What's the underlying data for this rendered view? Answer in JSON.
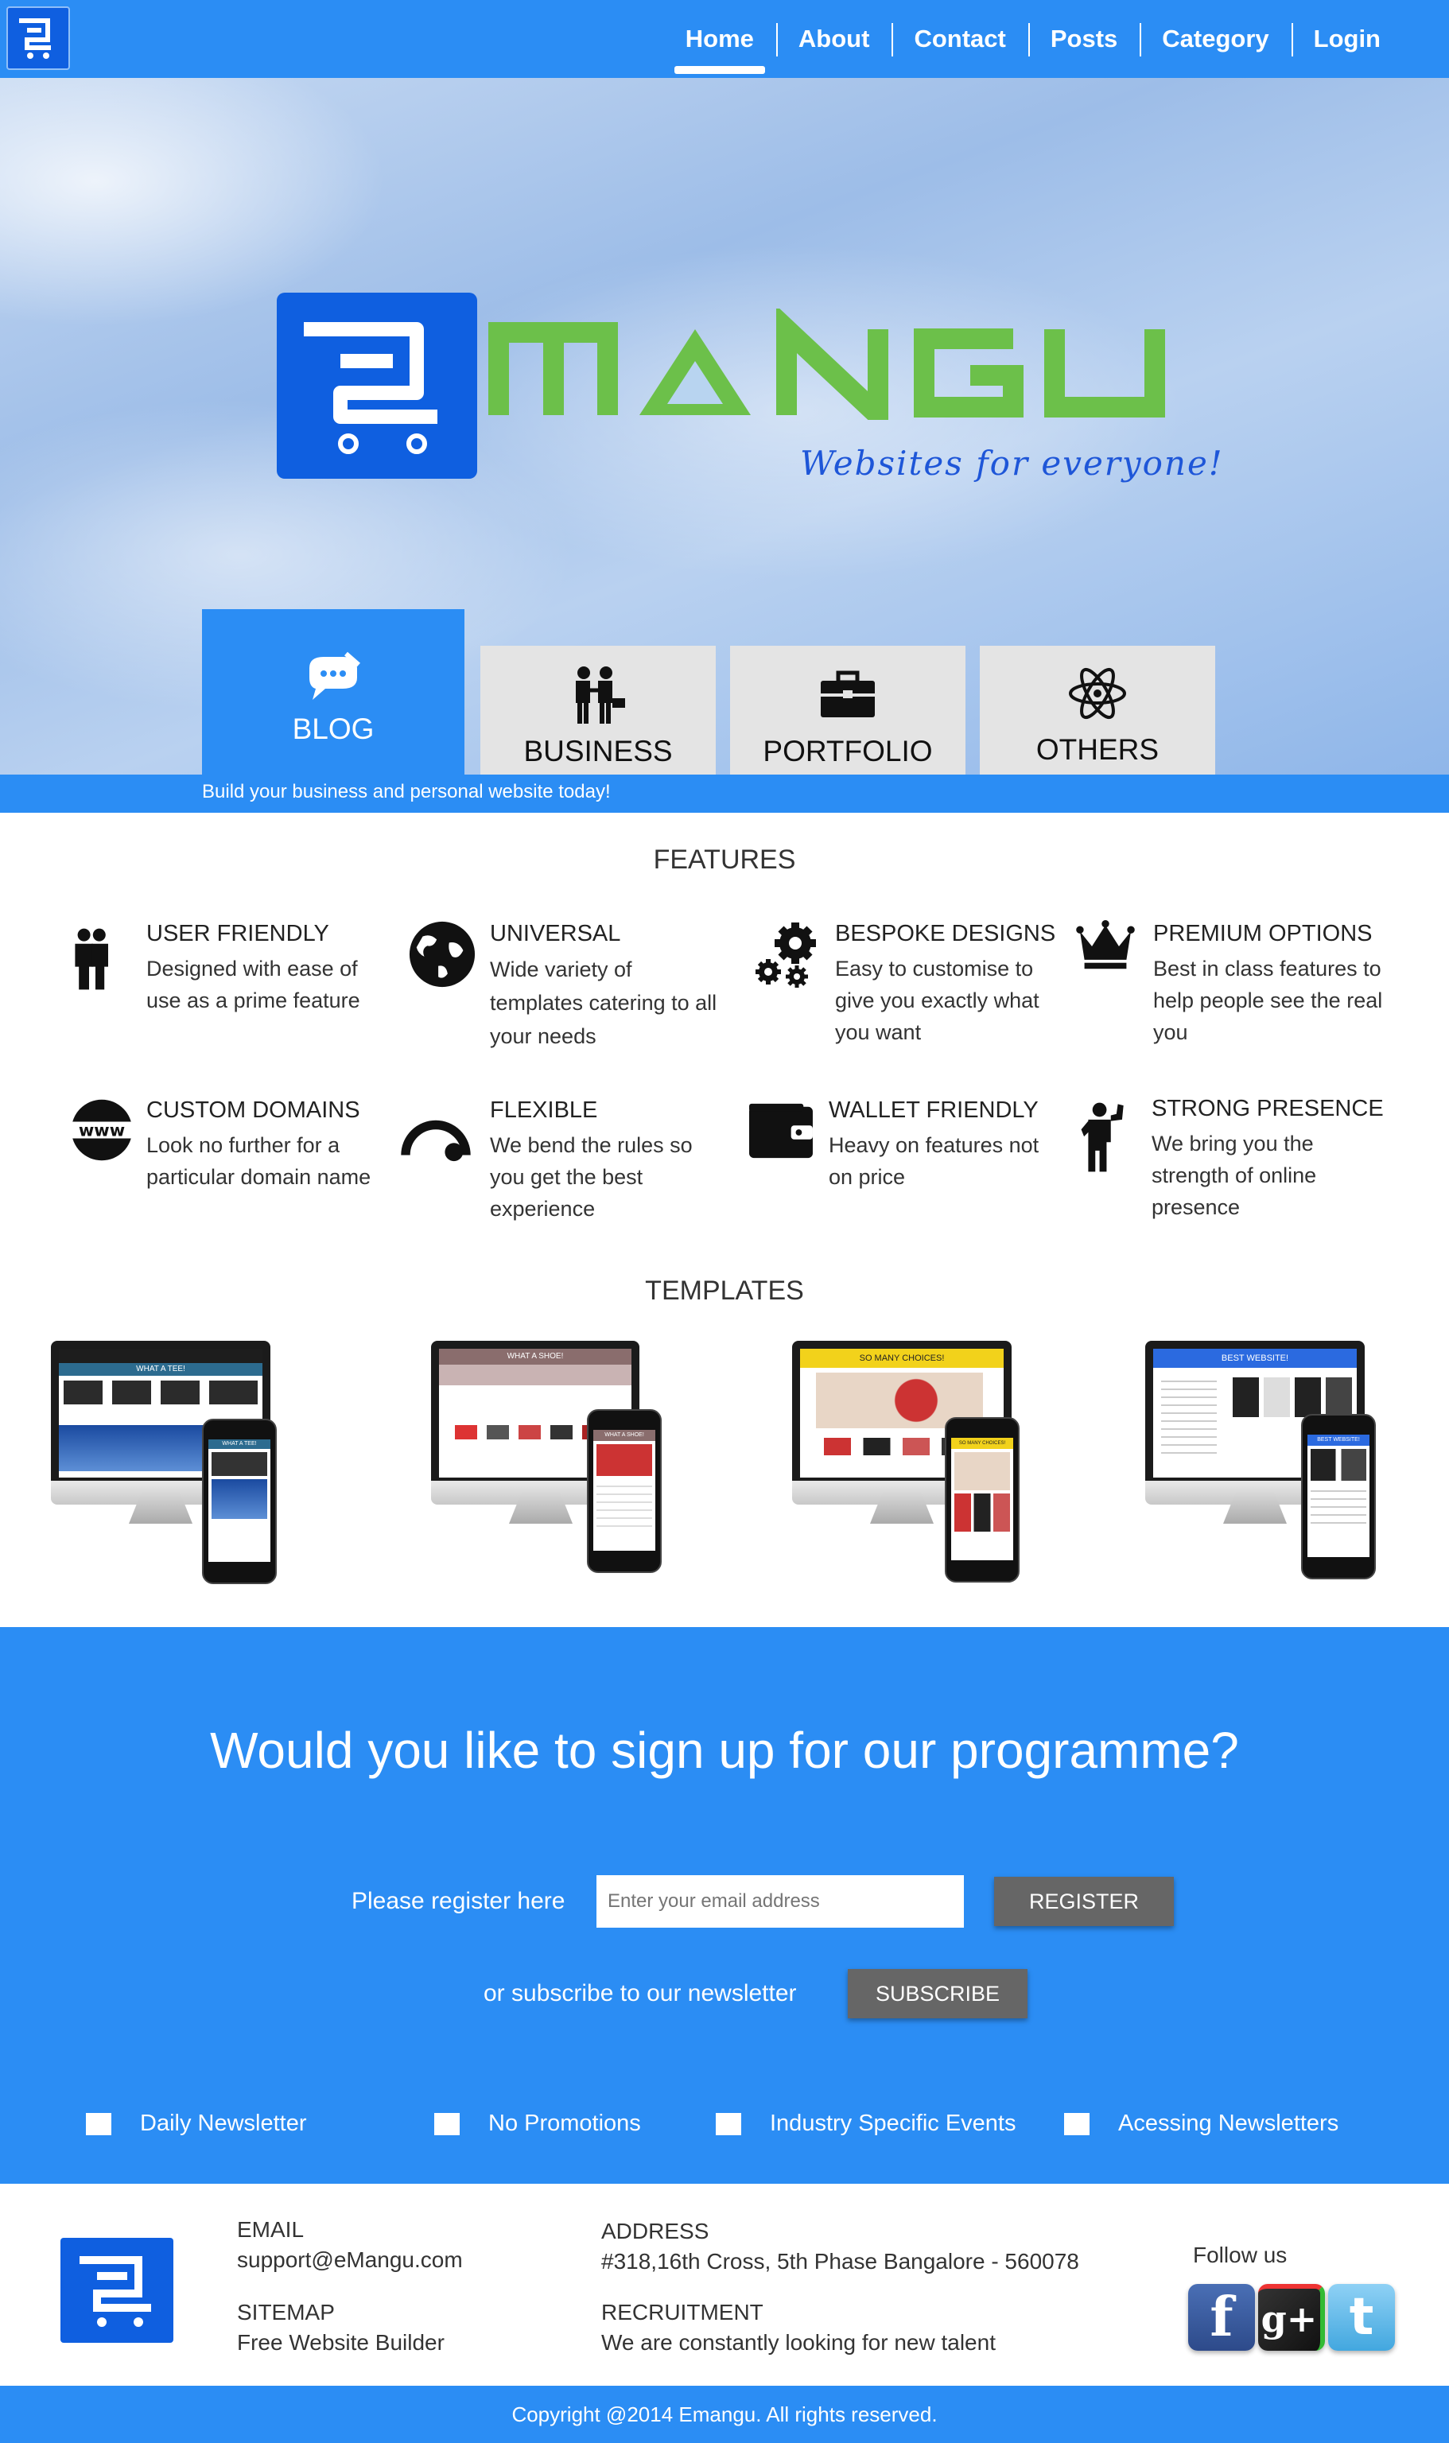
{
  "nav": {
    "items": [
      "Home",
      "About",
      "Contact",
      "Posts",
      "Category",
      "Login"
    ],
    "active": "Home",
    "logo_icon": "cart-e-icon"
  },
  "hero": {
    "brand_tag": "Websites for everyone!",
    "tabs": [
      {
        "label": "BLOG",
        "icon": "chat-bubble-icon"
      },
      {
        "label": "BUSINESS",
        "icon": "handshake-icon"
      },
      {
        "label": "PORTFOLIO",
        "icon": "briefcase-icon"
      },
      {
        "label": "OTHERS",
        "icon": "atom-icon"
      }
    ],
    "strip_text": "Build your business and personal website today!"
  },
  "features": {
    "title": "FEATURES",
    "items": [
      {
        "title": "USER FRIENDLY",
        "desc": "Designed with ease of use as a prime feature",
        "icon": "people-icon"
      },
      {
        "title": "UNIVERSAL",
        "desc": "Wide variety of templates catering to all your needs",
        "icon": "globe-icon"
      },
      {
        "title": "BESPOKE DESIGNS",
        "desc": "Easy to customise to give you exactly what you want",
        "icon": "gears-icon"
      },
      {
        "title": "PREMIUM OPTIONS",
        "desc": "Best in class features to help people see the real you",
        "icon": "crown-icon"
      },
      {
        "title": "CUSTOM DOMAINS",
        "desc": "Look no further for a particular domain name",
        "icon": "www-icon"
      },
      {
        "title": "FLEXIBLE",
        "desc": "We bend the rules so you get the best experience",
        "icon": "gauge-icon"
      },
      {
        "title": "WALLET FRIENDLY",
        "desc": "Heavy on features not on price",
        "icon": "wallet-icon"
      },
      {
        "title": "STRONG PRESENCE",
        "desc": "We bring you the strength of online presence",
        "icon": "strongman-icon"
      }
    ]
  },
  "templates": {
    "title": "TEMPLATES",
    "items": [
      {
        "banner": "WHAT A TEE!",
        "phone_banner": "WHAT A TEE!",
        "accent": "#2c6b8f"
      },
      {
        "banner": "WHAT A SHOE!",
        "phone_banner": "WHAT A SHOE!",
        "accent": "#8a6d6d"
      },
      {
        "banner": "SO MANY CHOICES!",
        "phone_banner": "SO MANY CHOICES!",
        "accent": "#f2d21b"
      },
      {
        "banner": "BEST WEBSITE!",
        "phone_banner": "BEST WEBSITE!",
        "accent": "#2b6ae0"
      }
    ]
  },
  "signup": {
    "heading": "Would you like to sign up for our programme?",
    "register_label": "Please register here",
    "email_placeholder": "Enter your email address",
    "register_button": "REGISTER",
    "subscribe_label": "or subscribe to our newsletter",
    "subscribe_button": "SUBSCRIBE",
    "options": [
      "Daily Newsletter",
      "No Promotions",
      "Industry Specific Events",
      "Acessing Newsletters"
    ]
  },
  "footer": {
    "email_label": "EMAIL",
    "email_value": "support@eMangu.com",
    "sitemap_label": "SITEMAP",
    "sitemap_value": "Free Website Builder",
    "address_label": "ADDRESS",
    "address_value": "#318,16th Cross, 5th Phase Bangalore - 560078",
    "recruitment_label": "RECRUITMENT",
    "recruitment_value": "We are constantly looking for new talent",
    "follow_label": "Follow us",
    "social": [
      {
        "name": "facebook",
        "glyph": "f",
        "color": "#3b5998"
      },
      {
        "name": "google-plus",
        "glyph": "g+",
        "color": "#222222"
      },
      {
        "name": "twitter",
        "glyph": "t",
        "color": "#55acee"
      }
    ],
    "copyright": "Copyright @2014 Emangu. All rights reserved."
  },
  "colors": {
    "primary_blue": "#2b8df4",
    "logo_blue": "#0f5fe0",
    "brand_green": "#6cc04a",
    "button_gray": "#666666"
  }
}
